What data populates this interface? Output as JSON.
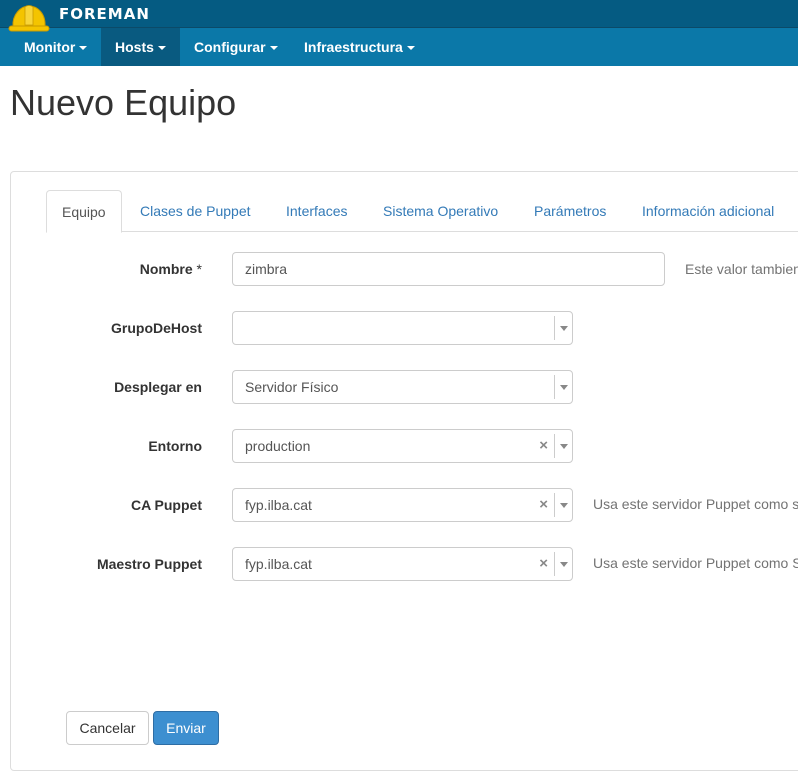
{
  "app": {
    "brand": "FOREMAN"
  },
  "nav": {
    "items": [
      {
        "label": "Monitor"
      },
      {
        "label": "Hosts"
      },
      {
        "label": "Configurar"
      },
      {
        "label": "Infraestructura"
      }
    ],
    "active_index": 1
  },
  "page": {
    "title": "Nuevo Equipo"
  },
  "tabs": [
    {
      "label": "Equipo"
    },
    {
      "label": "Clases de Puppet"
    },
    {
      "label": "Interfaces"
    },
    {
      "label": "Sistema Operativo"
    },
    {
      "label": "Parámetros"
    },
    {
      "label": "Información adicional"
    }
  ],
  "form": {
    "nombre": {
      "label": "Nombre",
      "required_mark": "*",
      "value": "zimbra",
      "help": "Este valor tambien"
    },
    "grupo": {
      "label": "GrupoDeHost",
      "value": ""
    },
    "desplegar": {
      "label": "Desplegar en",
      "value": "Servidor Físico"
    },
    "entorno": {
      "label": "Entorno",
      "value": "production",
      "clear": "×"
    },
    "ca_puppet": {
      "label": "CA Puppet",
      "value": "fyp.ilba.cat",
      "clear": "×",
      "help": "Usa este servidor Puppet como s"
    },
    "maestro": {
      "label": "Maestro Puppet",
      "value": "fyp.ilba.cat",
      "clear": "×",
      "help": "Usa este servidor Puppet como S"
    }
  },
  "buttons": {
    "cancel": "Cancelar",
    "submit": "Enviar"
  },
  "colors": {
    "brandbar": "#055b82",
    "navbar": "#0b78a8",
    "primary": "#3d8fd0",
    "link": "#337ab7"
  },
  "icons": {
    "logo": "hard-hat-icon",
    "caret": "caret-down-icon",
    "clear": "clear-x-icon",
    "dropdown": "dropdown-arrow-icon"
  }
}
